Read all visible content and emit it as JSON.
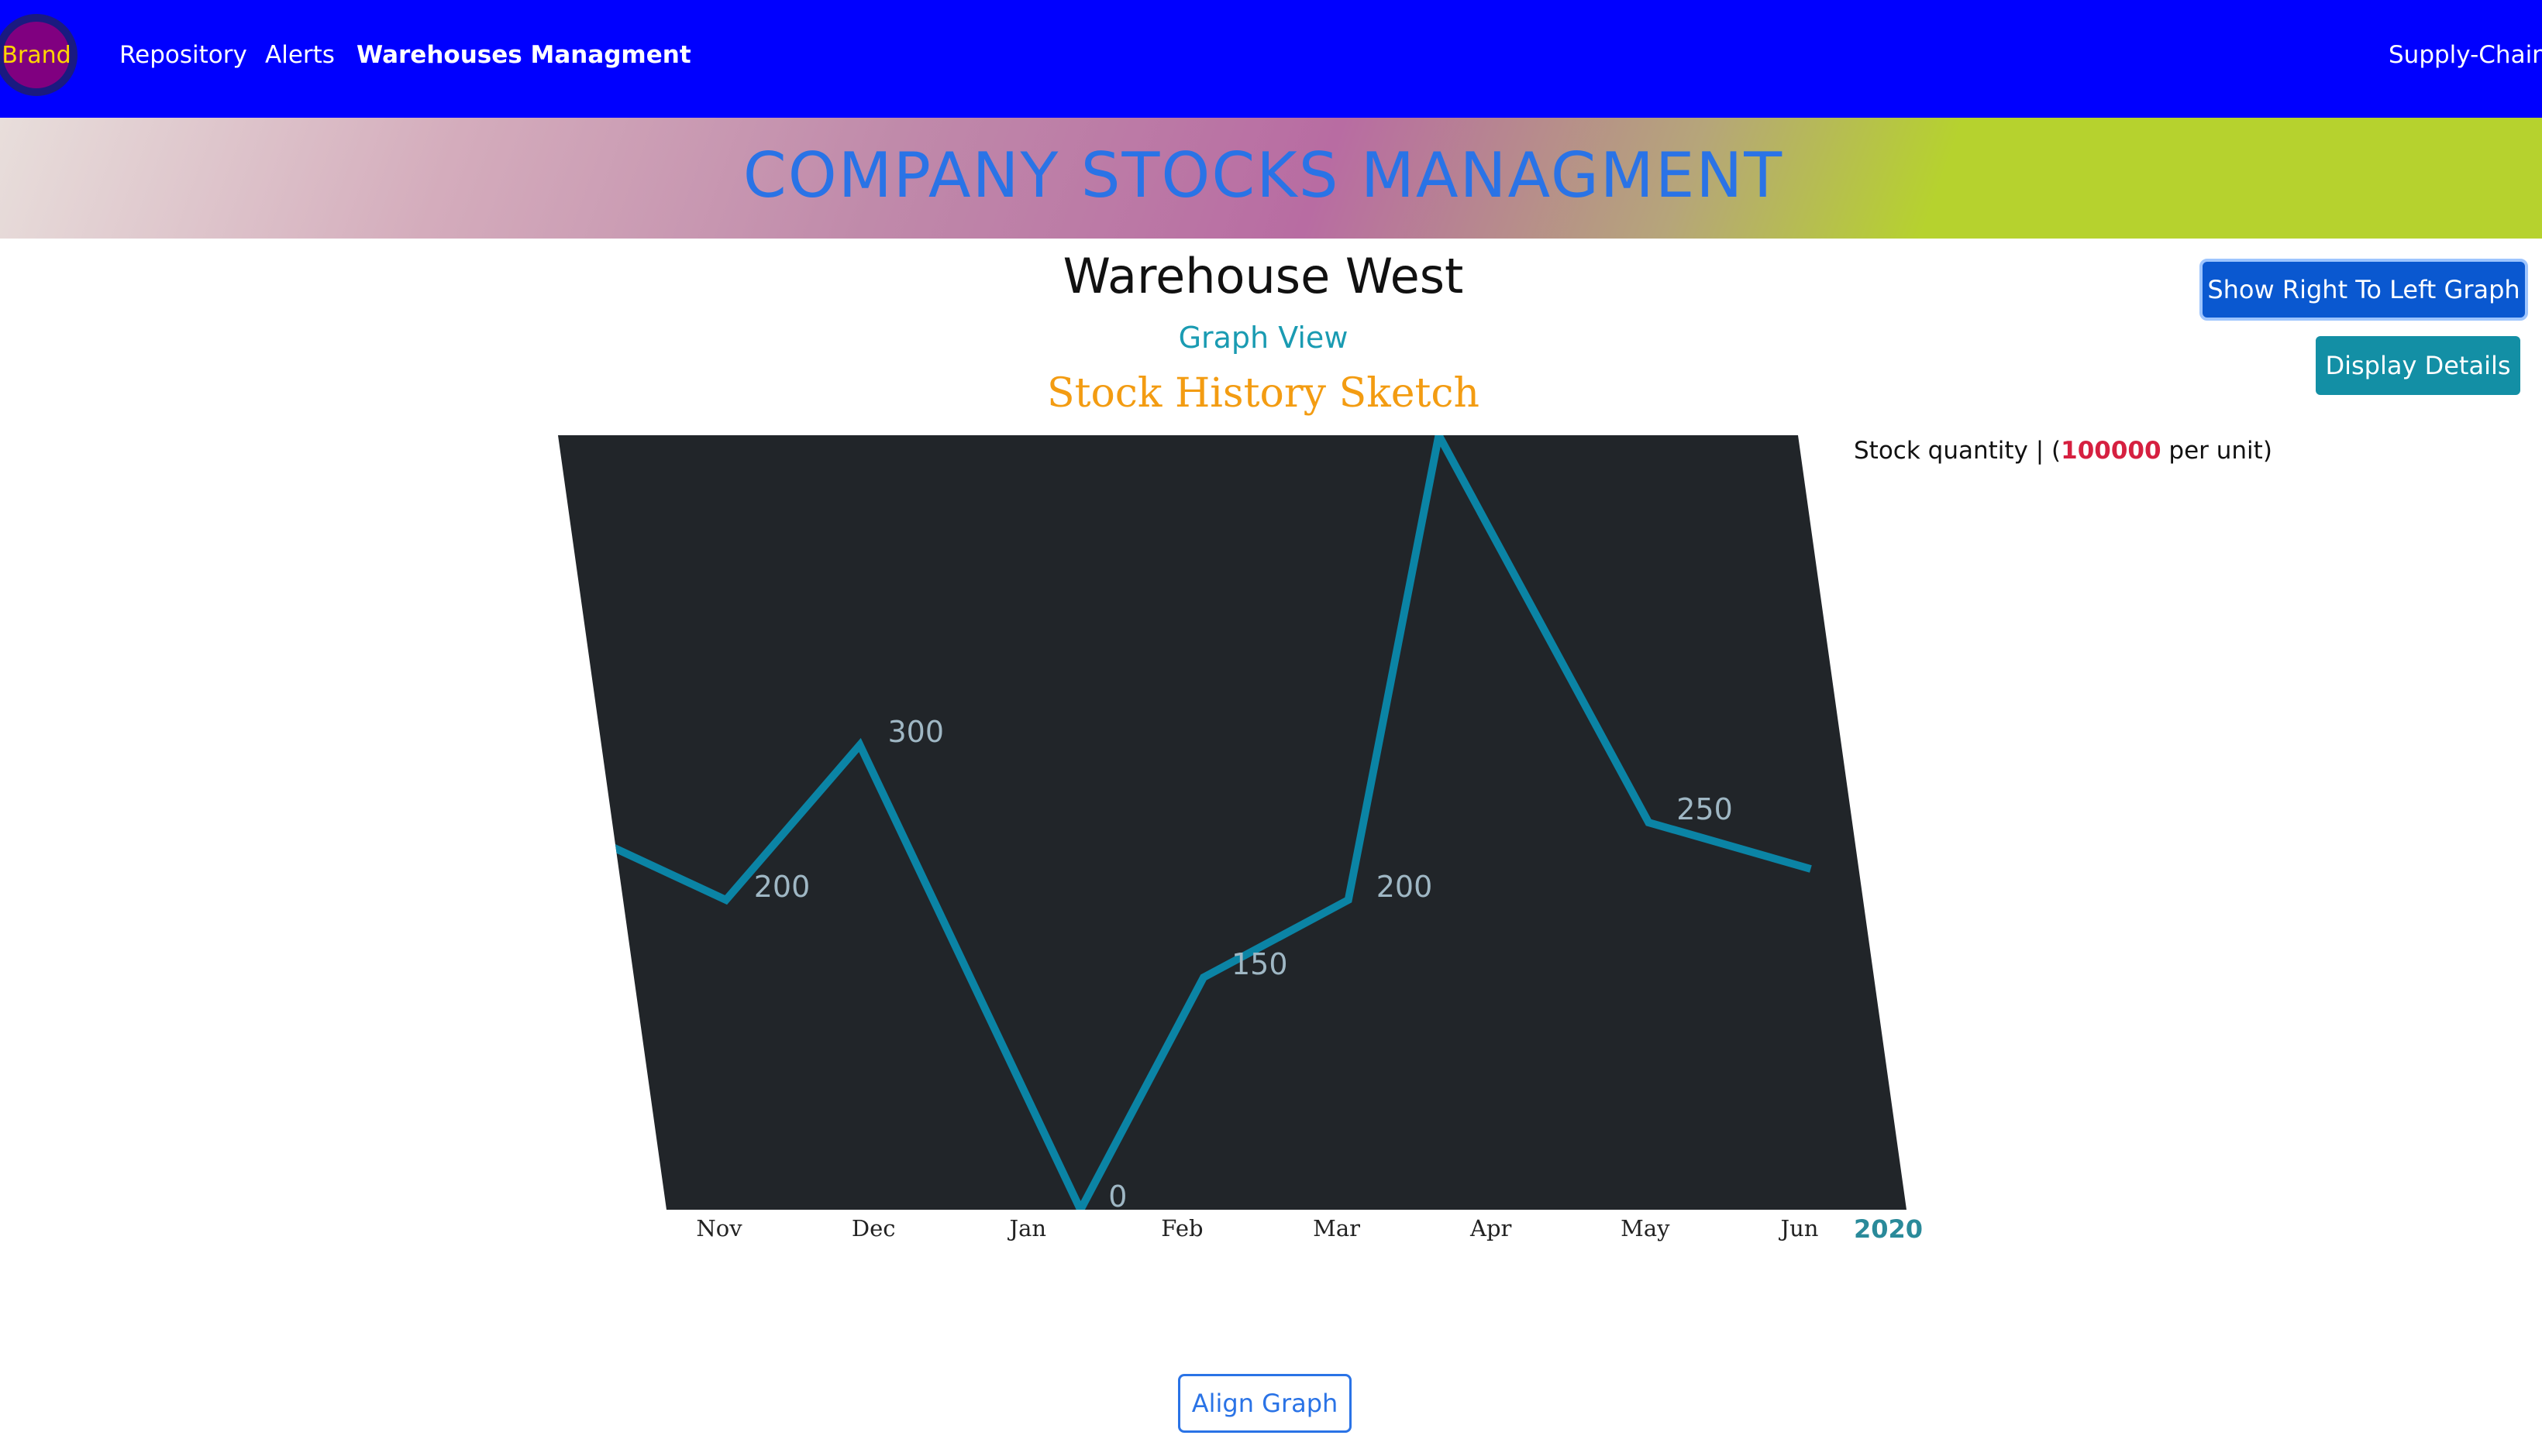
{
  "nav": {
    "brand": "Brand",
    "links": [
      "Repository",
      "Alerts",
      "Warehouses Managment"
    ],
    "right_link": "Supply-Chain"
  },
  "banner": {
    "title": "COMPANY STOCKS MANAGMENT"
  },
  "warehouse": {
    "title": "Warehouse West",
    "view_label": "Graph View",
    "sketch_title": "Stock History Sketch"
  },
  "buttons": {
    "show_rtl": "Show Right To Left Graph",
    "display_details": "Display Details",
    "align_graph": "Align Graph"
  },
  "stock_label": {
    "prefix": "Stock quantity | (",
    "unit_value": "100000",
    "suffix": " per unit)"
  },
  "colors": {
    "nav_bg": "#0000ff",
    "chart_bg": "#212529",
    "line": "#0b84a5",
    "value_label": "#9fb7c4",
    "year_label": "#2a8a9a"
  },
  "chart_data": {
    "type": "line",
    "categories": [
      "Nov",
      "Dec",
      "Jan",
      "Feb",
      "Mar",
      "Apr",
      "May",
      "Jun"
    ],
    "year_label": "2020",
    "series": [
      {
        "values": [
          250,
          200,
          300,
          0,
          150,
          200,
          500,
          250,
          220
        ],
        "labels": [
          "",
          "200",
          "300",
          "0",
          "150",
          "200",
          "",
          "250",
          ""
        ]
      }
    ],
    "ylim": [
      0,
      500
    ],
    "xlabel": "",
    "ylabel": "",
    "grid": false,
    "legend": false
  }
}
